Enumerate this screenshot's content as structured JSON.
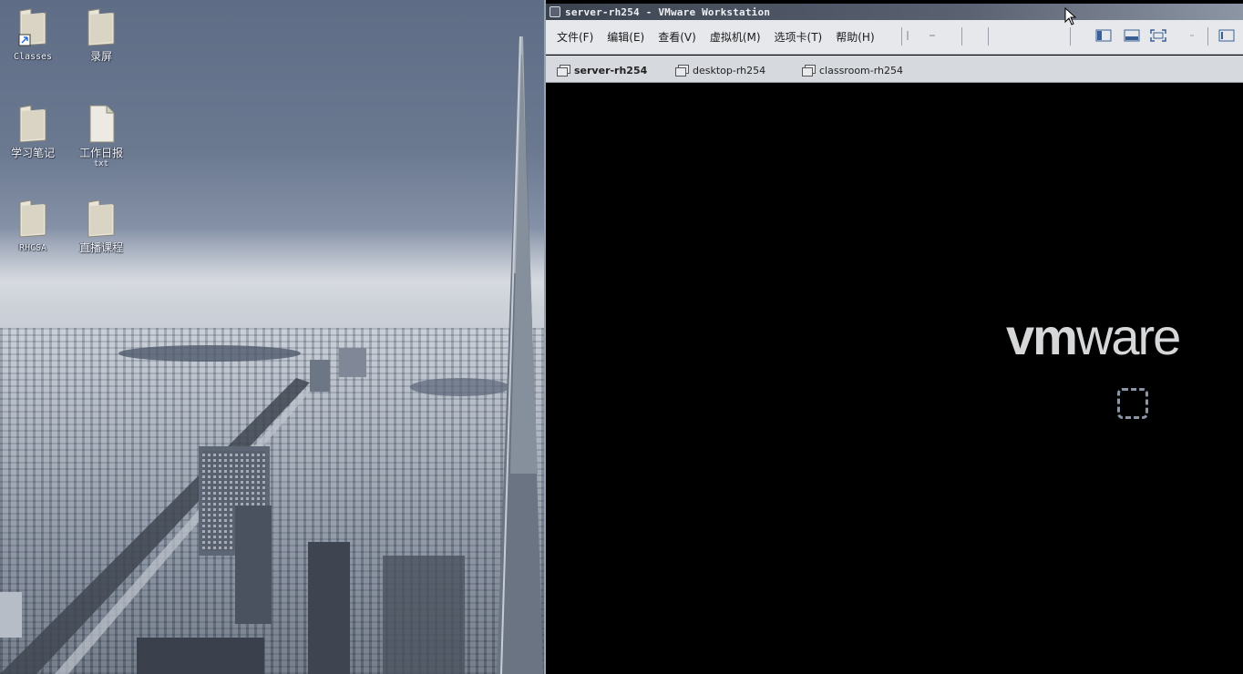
{
  "desktop": {
    "icons": [
      {
        "name": "classes",
        "label": "Classes",
        "sub": ""
      },
      {
        "name": "recording",
        "label": "录屏",
        "sub": ""
      },
      {
        "name": "study-notes",
        "label": "学习笔记",
        "sub": ""
      },
      {
        "name": "work-daily",
        "label": "工作日报",
        "sub": "txt"
      },
      {
        "name": "rhcsa",
        "label": "RHCSA",
        "sub": ""
      },
      {
        "name": "live-course",
        "label": "直播课程",
        "sub": ""
      }
    ]
  },
  "window": {
    "title": "server-rh254 - VMware Workstation",
    "menu": [
      "文件(F)",
      "编辑(E)",
      "查看(V)",
      "虚拟机(M)",
      "选项卡(T)",
      "帮助(H)"
    ],
    "tabs": [
      {
        "label": "server-rh254",
        "active": true
      },
      {
        "label": "desktop-rh254",
        "active": false
      },
      {
        "label": "classroom-rh254",
        "active": false
      }
    ],
    "vm_logo": {
      "bold": "vm",
      "light": "ware"
    }
  },
  "colors": {
    "menubar": "#e6e8ec",
    "tabbar": "#d6d9de",
    "vmscreen": "#000000",
    "logo": "#d6d7d9"
  }
}
